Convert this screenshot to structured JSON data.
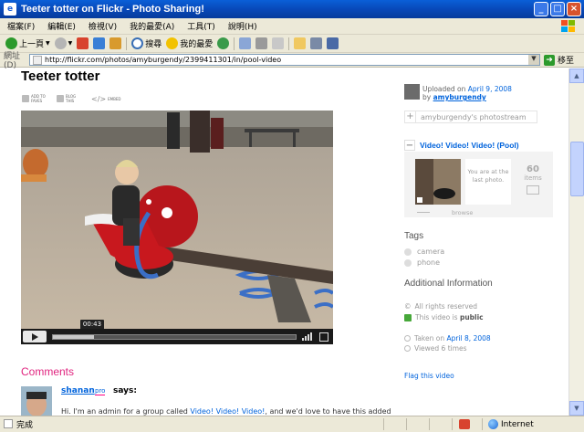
{
  "window": {
    "title": "Teeter totter on Flickr - Photo Sharing!"
  },
  "menu": [
    "檔案(F)",
    "編輯(E)",
    "檢視(V)",
    "我的最愛(A)",
    "工具(T)",
    "說明(H)"
  ],
  "toolbar": {
    "back": "上一頁",
    "search": "搜尋",
    "favorites": "我的最愛"
  },
  "address": {
    "label": "網址(D)",
    "url": "http://flickr.com/photos/amyburgendy/2399411301/in/pool-video",
    "go": "移至"
  },
  "status": {
    "text": "完成",
    "zone": "Internet"
  },
  "page": {
    "title": "Teeter totter",
    "actions": [
      "ADD TO FAVES",
      "BLOG THIS",
      "EMBED"
    ],
    "video": {
      "time": "00:43",
      "progress": 0.17
    },
    "comments": {
      "heading": "Comments",
      "user": "shanan",
      "pro": "pro",
      "says": "says:",
      "text_pre": "Hi. I'm an admin for a group called ",
      "text_link": "Video! Video! Video!",
      "text_post": ", and we'd love to have this added"
    }
  },
  "sidebar": {
    "uploaded_pre": "Uploaded on ",
    "uploaded_date": "April 9, 2008",
    "by": "by ",
    "user": "amyburgendy",
    "photostream": "amyburgendy's photostream",
    "pool": {
      "title": "Video! Video! Video! (Pool)",
      "last_text": "You are at the last photo.",
      "count": "60",
      "count_unit": "items",
      "browse": "browse"
    },
    "tags_heading": "Tags",
    "tags": [
      "camera",
      "phone"
    ],
    "info_heading": "Additional Information",
    "rights": "All rights reserved",
    "public_pre": "This video is ",
    "public_word": "public",
    "taken_pre": "Taken on ",
    "taken_date": "April 8, 2008",
    "views": "Viewed 6 times",
    "flag": "Flag this video"
  }
}
